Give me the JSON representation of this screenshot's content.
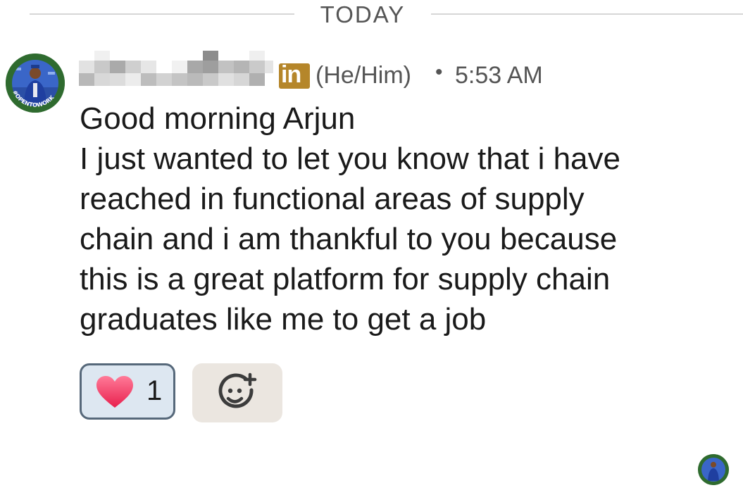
{
  "date_divider": {
    "label": "TODAY"
  },
  "sender": {
    "avatar_badge_text": "#OPENTOWORK",
    "platform_badge": "in",
    "pronouns": "(He/Him)",
    "separator": "•",
    "time": "5:53 AM"
  },
  "message": {
    "lines": [
      "Good morning Arjun",
      "I just wanted to let you know that i have",
      "reached in functional areas of supply",
      "chain and i am thankful to you because",
      "this is a great platform for supply chain",
      "graduates like me to get a job"
    ]
  },
  "reactions": [
    {
      "icon": "heart-icon",
      "count": "1",
      "color": "#f2406a"
    }
  ],
  "add_reaction": {
    "icon": "add-emoji-icon"
  },
  "colors": {
    "linkedin_badge": "#b5862a",
    "reaction_border": "#56687a",
    "reaction_bg": "#dde7f1",
    "add_reaction_bg": "#ebe6e0",
    "open_to_work_ring": "#2f6b2f"
  }
}
